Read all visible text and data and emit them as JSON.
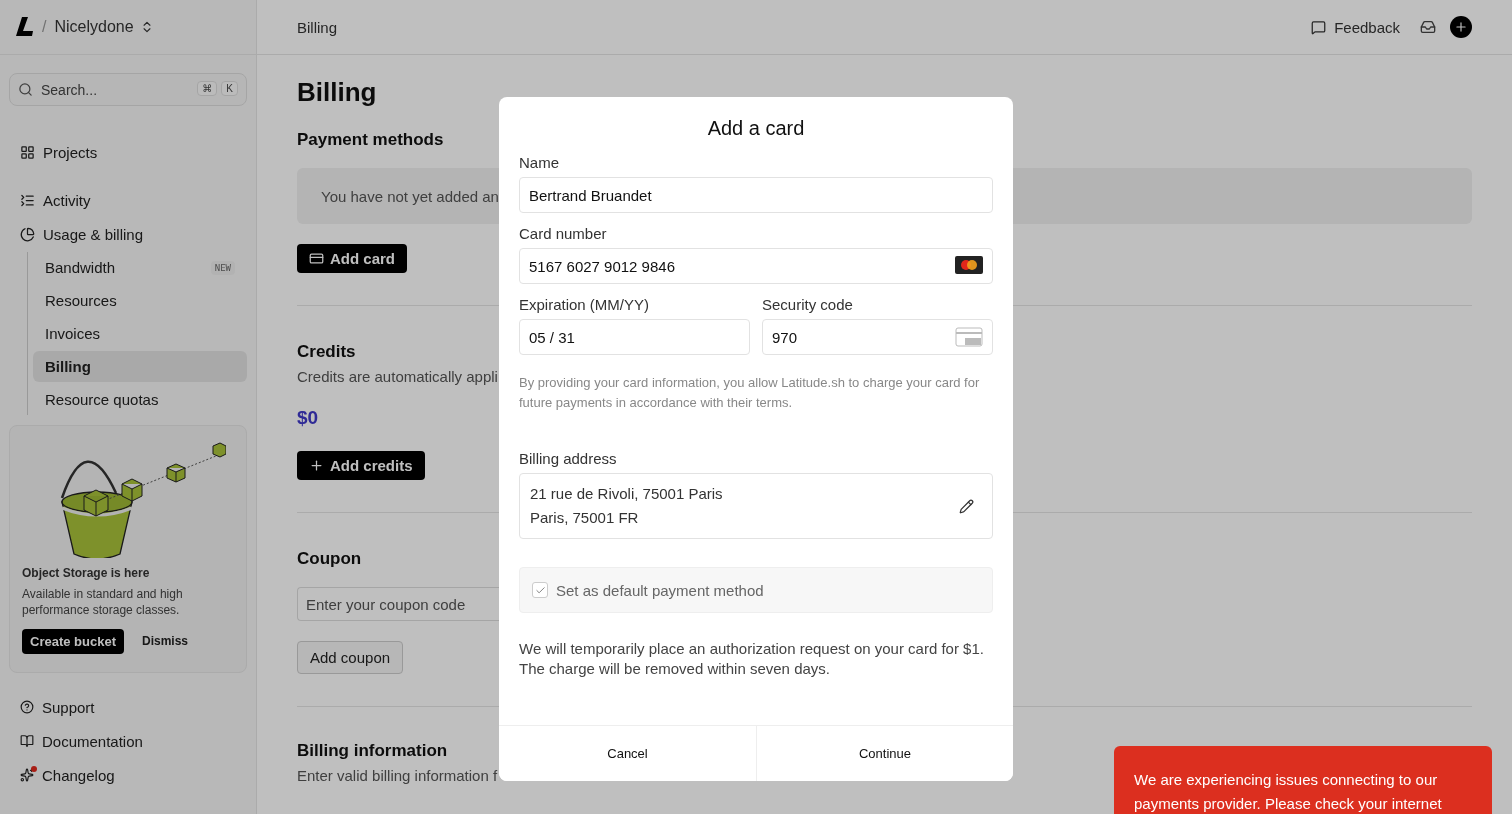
{
  "workspace": {
    "separator": "/",
    "name": "Nicelydone"
  },
  "search": {
    "placeholder": "Search...",
    "shortcut": [
      "⌘",
      "K"
    ]
  },
  "nav": [
    {
      "label": "Projects",
      "selected": false
    },
    {
      "label": "Activity",
      "selected": false
    },
    {
      "label": "Usage & billing",
      "selected": false,
      "children": [
        {
          "label": "Bandwidth",
          "badge": "NEW",
          "selected": false
        },
        {
          "label": "Resources",
          "selected": false
        },
        {
          "label": "Invoices",
          "selected": false
        },
        {
          "label": "Billing",
          "selected": true
        },
        {
          "label": "Resource quotas",
          "selected": false
        }
      ]
    }
  ],
  "promo": {
    "title": "Object Storage is here",
    "text": "Available in standard and high performance storage classes.",
    "primary": "Create bucket",
    "secondary": "Dismiss"
  },
  "footer_nav": [
    {
      "label": "Support",
      "dot": false
    },
    {
      "label": "Documentation",
      "dot": false
    },
    {
      "label": "Changelog",
      "dot": true
    }
  ],
  "topbar": {
    "breadcrumb": "Billing",
    "feedback": "Feedback"
  },
  "page": {
    "title": "Billing",
    "payment_methods": {
      "title": "Payment methods",
      "empty": "You have not yet added an",
      "button": "Add card"
    },
    "credits": {
      "title": "Credits",
      "text": "Credits are automatically appli",
      "amount": "$0",
      "button": "Add credits"
    },
    "coupon": {
      "title": "Coupon",
      "placeholder": "Enter your coupon code",
      "button": "Add coupon"
    },
    "billing_information": {
      "title": "Billing information",
      "text": "Enter valid billing information f"
    }
  },
  "modal": {
    "title": "Add a card",
    "name": {
      "label": "Name",
      "value": "Bertrand Bruandet"
    },
    "card_number": {
      "label": "Card number",
      "value": "5167 6027 9012 9846"
    },
    "expiration": {
      "label": "Expiration (MM/YY)",
      "value": "05 / 31"
    },
    "security_code": {
      "label": "Security code",
      "value": "970"
    },
    "notice": "By providing your card information, you allow Latitude.sh to charge your card for future payments in accordance with their terms.",
    "billing_address": {
      "label": "Billing address",
      "lines": [
        "21 rue de Rivoli, 75001 Paris",
        "Paris, 75001 FR"
      ]
    },
    "default_method": {
      "label": "Set as default payment method",
      "checked": true
    },
    "authorization": "We will temporarily place an authorization request on your card for $1. The charge will be removed within seven days.",
    "buttons": [
      "Cancel",
      "Continue"
    ]
  },
  "toast": {
    "text": "We are experiencing issues connecting to our payments provider. Please check your internet"
  }
}
